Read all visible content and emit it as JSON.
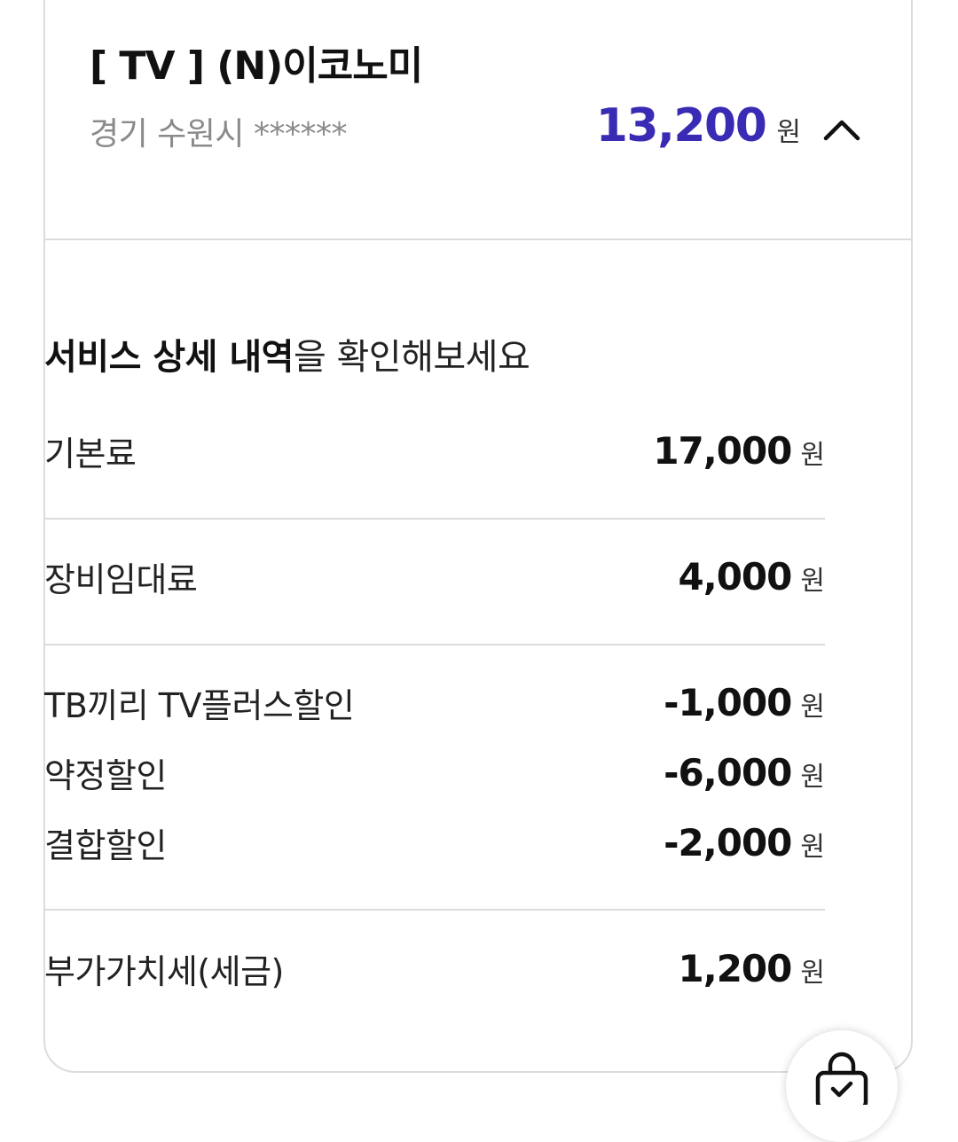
{
  "header": {
    "plan_title": "[ TV ] (N)이코노미",
    "address": "경기 수원시 ******",
    "total_amount": "13,200",
    "total_unit": "원",
    "accent_color": "#3a2bb5"
  },
  "details": {
    "heading_strong": "서비스 상세 내역",
    "heading_rest": "을 확인해보세요",
    "rows": [
      {
        "label": "기본료",
        "amount": "17,000",
        "unit": "원"
      },
      {
        "label": "장비임대료",
        "amount": "4,000",
        "unit": "원"
      },
      {
        "label": "TB끼리 TV플러스할인",
        "amount": "-1,000",
        "unit": "원"
      },
      {
        "label": "약정할인",
        "amount": "-6,000",
        "unit": "원"
      },
      {
        "label": "결합할인",
        "amount": "-2,000",
        "unit": "원"
      },
      {
        "label": "부가가치세(세금)",
        "amount": "1,200",
        "unit": "원"
      }
    ]
  },
  "icons": {
    "collapse": "chevron-up-icon",
    "floating": "shopping-bag-check-icon"
  }
}
